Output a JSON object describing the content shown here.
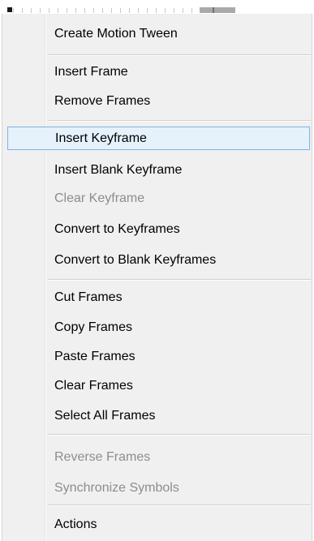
{
  "menu": {
    "items": [
      {
        "label": "Create Motion Tween"
      },
      {
        "label": "Insert Frame"
      },
      {
        "label": "Remove Frames"
      },
      {
        "label": "Insert Keyframe"
      },
      {
        "label": "Insert Blank Keyframe"
      },
      {
        "label": "Clear Keyframe"
      },
      {
        "label": "Convert to Keyframes"
      },
      {
        "label": "Convert to Blank Keyframes"
      },
      {
        "label": "Cut Frames"
      },
      {
        "label": "Copy Frames"
      },
      {
        "label": "Paste Frames"
      },
      {
        "label": "Clear Frames"
      },
      {
        "label": "Select All Frames"
      },
      {
        "label": "Reverse Frames"
      },
      {
        "label": "Synchronize Symbols"
      },
      {
        "label": "Actions"
      }
    ]
  },
  "state": {
    "highlighted_item": "Insert Keyframe",
    "disabled_items": [
      "Clear Keyframe",
      "Reverse Frames",
      "Synchronize Symbols"
    ]
  },
  "colors": {
    "menu_background": "#f0f0f0",
    "highlight_background": "#e5f1fb",
    "highlight_border": "#7fb3e3",
    "disabled_text": "#8d8d8d"
  }
}
